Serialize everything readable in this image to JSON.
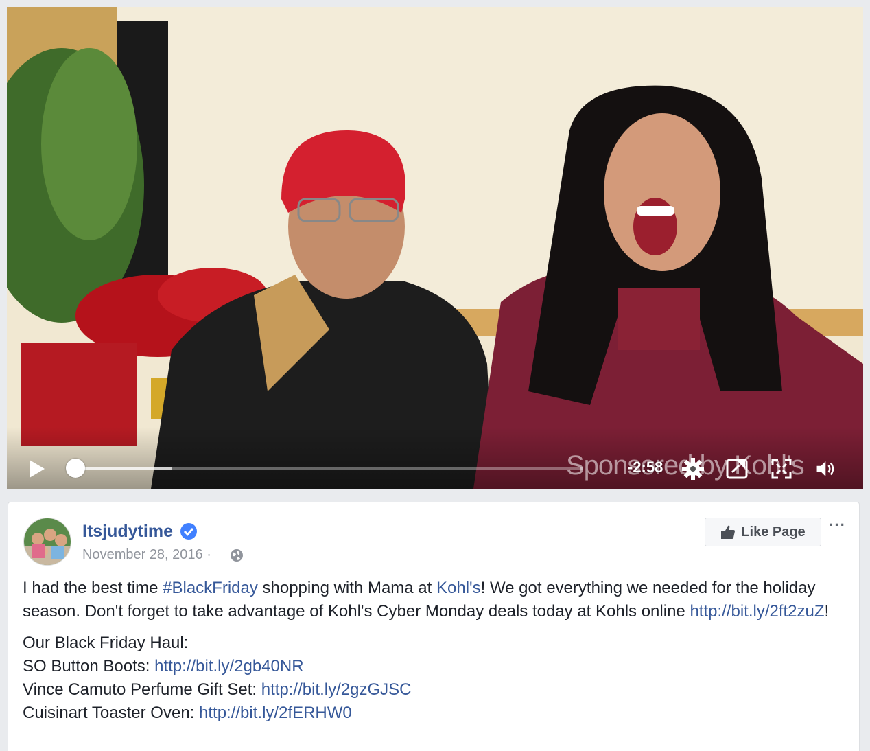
{
  "video": {
    "sponsor_overlay": "Sponsored by Kohl's",
    "time_remaining": "-2:58",
    "progress_buffered_fraction": 0.19,
    "progress_played_fraction": 0.0,
    "icons": [
      "play-icon",
      "settings-icon",
      "picture-in-picture-icon",
      "fullscreen-icon",
      "volume-icon"
    ]
  },
  "post": {
    "page_name": "Itsjudytime",
    "date": "November 28, 2016",
    "date_separator": "·",
    "like_button_label": "Like Page",
    "more_label": "···",
    "paragraph1": {
      "t1": "I had the best time ",
      "hashtag": "#BlackFriday",
      "t2": " shopping with Mama at ",
      "mention": "Kohl's",
      "t3": "! We got everything we needed for the holiday season. Don't forget to take advantage of Kohl's Cyber Monday deals today at Kohls online ",
      "link": "http://bit.ly/2ft2zuZ",
      "t4": "!"
    },
    "haul_title": "Our Black Friday Haul:",
    "haul_items": [
      {
        "label": "SO Button Boots: ",
        "link": "http://bit.ly/2gb40NR"
      },
      {
        "label": "Vince Camuto Perfume Gift Set: ",
        "link": "http://bit.ly/2gzGJSC"
      },
      {
        "label": "Cuisinart Toaster Oven: ",
        "link": "http://bit.ly/2fERHW0"
      }
    ]
  },
  "colors": {
    "link": "#365899",
    "text": "#1d2129",
    "meta": "#90949c",
    "verified": "#4080ff",
    "page_bg": "#e9ebee"
  }
}
